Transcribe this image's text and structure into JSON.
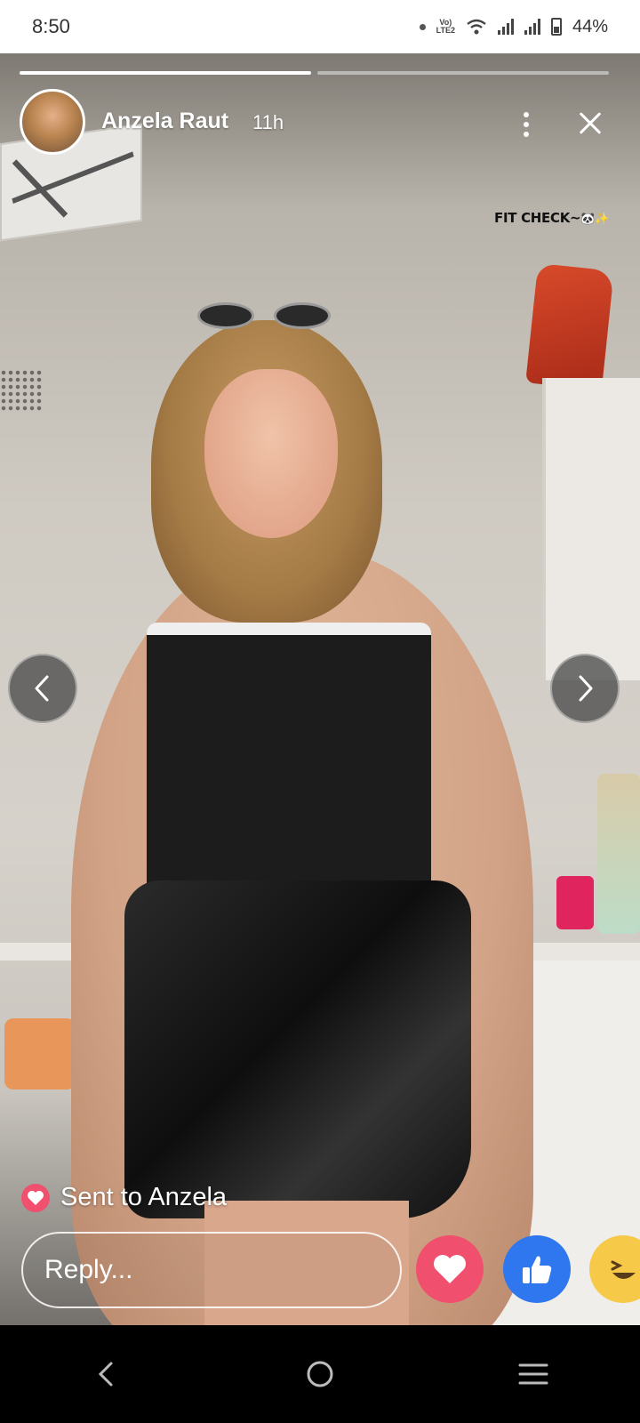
{
  "status_bar": {
    "time": "8:50",
    "network_label": "Vo) LTE2",
    "battery": "44%"
  },
  "story": {
    "progress": [
      1.0,
      0.0
    ],
    "username": "Anzela Raut",
    "time_ago": "11h",
    "caption": "FIT CHECK~",
    "caption_emoji": "🐼✨"
  },
  "sent_label": "Sent to Anzela",
  "reply": {
    "placeholder": "Reply..."
  },
  "reactions": [
    "love",
    "like",
    "haha"
  ],
  "colors": {
    "love": "#f0506e",
    "like": "#2f77ee",
    "haha": "#f7c948",
    "nav_bar": "#000000"
  },
  "icons": {
    "more": "more-vertical-icon",
    "close": "close-icon",
    "prev": "chevron-left-icon",
    "next": "chevron-right-icon"
  }
}
